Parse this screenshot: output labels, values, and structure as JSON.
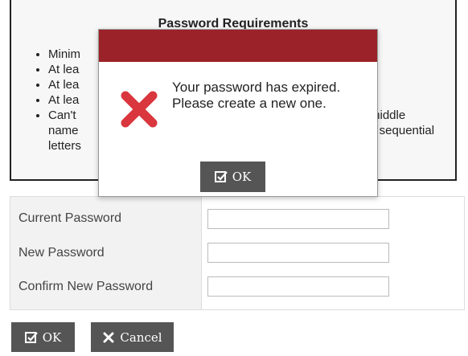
{
  "requirements": {
    "title": "Password Requirements",
    "items": [
      "Minim",
      "At lea",
      "At lea",
      "At lea",
      "Can't",
      "name",
      "letters",
      "middle",
      "y sequential"
    ]
  },
  "form": {
    "current_label": "Current Password",
    "new_label": "New Password",
    "confirm_label": "Confirm New Password",
    "current_value": "",
    "new_value": "",
    "confirm_value": ""
  },
  "buttons": {
    "ok_label": "OK",
    "cancel_label": "Cancel"
  },
  "dialog": {
    "message": "Your password has expired. Please create a new one.",
    "ok_label": "OK",
    "header_color": "#9b2228",
    "icon": "error-x-icon",
    "icon_color": "#d9363e"
  }
}
